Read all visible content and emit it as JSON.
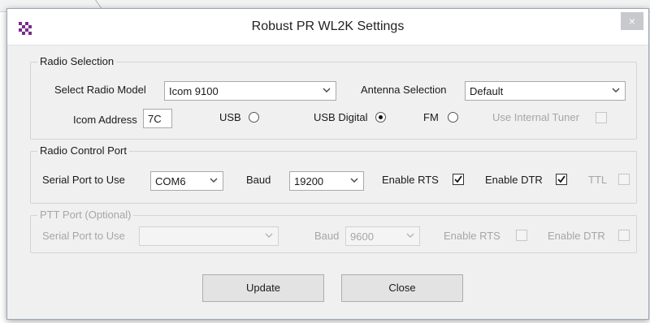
{
  "window": {
    "title": "Robust PR WL2K Settings",
    "close_label": "×"
  },
  "radio_selection": {
    "legend": "Radio Selection",
    "model_label": "Select Radio Model",
    "model_value": "Icom 9100",
    "antenna_label": "Antenna Selection",
    "antenna_value": "Default",
    "address_label": "Icom Address",
    "address_value": "7C",
    "usb_label": "USB",
    "usb_digital_label": "USB Digital",
    "fm_label": "FM",
    "selected_mode": "USB Digital",
    "tuner_label": "Use Internal Tuner"
  },
  "control_port": {
    "legend": "Radio Control Port",
    "serial_label": "Serial Port to Use",
    "serial_value": "COM6",
    "baud_label": "Baud",
    "baud_value": "19200",
    "rts_label": "Enable RTS",
    "rts_checked": true,
    "dtr_label": "Enable DTR",
    "dtr_checked": true,
    "ttl_label": "TTL",
    "ttl_checked": false
  },
  "ptt_port": {
    "legend": "PTT Port (Optional)",
    "serial_label": "Serial Port to Use",
    "serial_value": "",
    "baud_label": "Baud",
    "baud_value": "9600",
    "rts_label": "Enable RTS",
    "dtr_label": "Enable DTR"
  },
  "buttons": {
    "update": "Update",
    "close": "Close"
  },
  "colors": {
    "window_bg": "#f0f0f0",
    "titlebar_bg": "#ffffff",
    "close_bg": "#c7c9cd",
    "disabled_text": "#a6a6a6"
  },
  "icons": {
    "app": "checkered-app-icon",
    "chevron": "chevron-down-icon",
    "check": "checkmark-icon"
  }
}
